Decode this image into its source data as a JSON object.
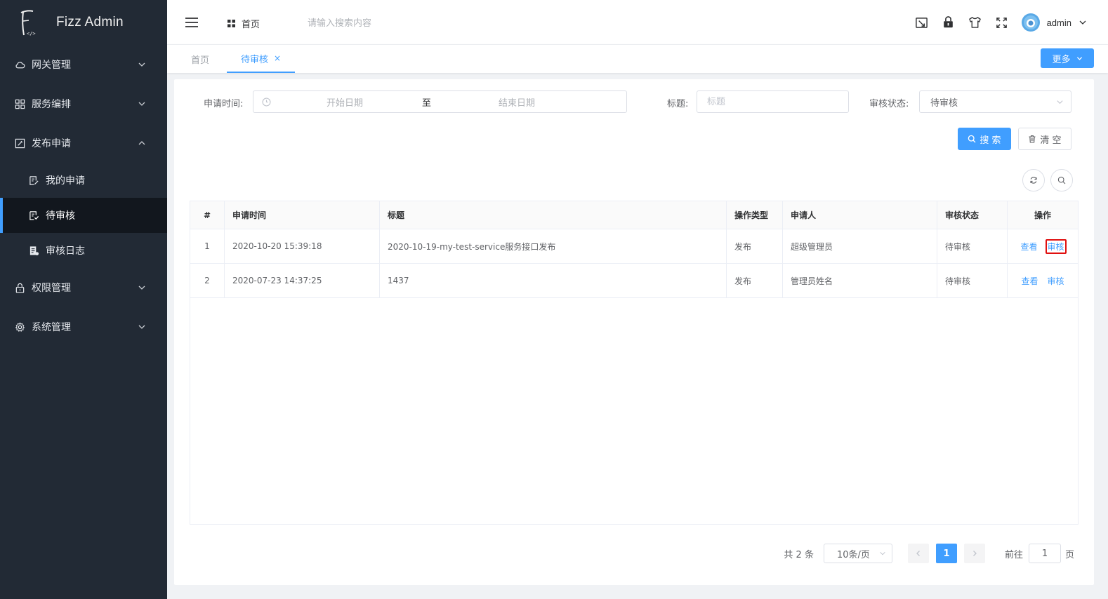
{
  "app": {
    "title": "Fizz Admin"
  },
  "sidebar": {
    "menus": [
      {
        "label": "网关管理",
        "icon": "cloud-icon",
        "expanded": false
      },
      {
        "label": "服务编排",
        "icon": "grid-icon",
        "expanded": false
      },
      {
        "label": "发布申请",
        "icon": "edit-box-icon",
        "expanded": true,
        "children": [
          {
            "label": "我的申请",
            "icon": "document-edit-icon",
            "active": false
          },
          {
            "label": "待审核",
            "icon": "document-check-icon",
            "active": true
          },
          {
            "label": "审核日志",
            "icon": "document-log-icon",
            "active": false
          }
        ]
      },
      {
        "label": "权限管理",
        "icon": "lock-icon",
        "expanded": false
      },
      {
        "label": "系统管理",
        "icon": "gear-icon",
        "expanded": false
      }
    ]
  },
  "header": {
    "breadcrumb": "首页",
    "search_placeholder": "请输入搜索内容",
    "user_name": "admin"
  },
  "tabs": [
    {
      "label": "首页",
      "active": false
    },
    {
      "label": "待审核",
      "active": true,
      "close": "×"
    }
  ],
  "more_button": "更多",
  "filters": {
    "date_label": "申请时间:",
    "start_placeholder": "开始日期",
    "range_separator": "至",
    "end_placeholder": "结束日期",
    "title_label": "标题:",
    "title_placeholder": "标题",
    "status_label": "审核状态:",
    "status_value": "待审核"
  },
  "buttons": {
    "search": "搜 索",
    "clear": "清 空"
  },
  "table": {
    "headers": [
      "#",
      "申请时间",
      "标题",
      "操作类型",
      "申请人",
      "审核状态",
      "操作"
    ],
    "rows": [
      {
        "index": "1",
        "time": "2020-10-20 15:39:18",
        "title": "2020-10-19-my-test-service服务接口发布",
        "op_type": "发布",
        "applicant": "超级管理员",
        "status": "待审核",
        "view": "查看",
        "review": "审核"
      },
      {
        "index": "2",
        "time": "2020-07-23 14:37:25",
        "title": "1437",
        "op_type": "发布",
        "applicant": "管理员姓名",
        "status": "待审核",
        "view": "查看",
        "review": "审核"
      }
    ]
  },
  "pagination": {
    "total": "共 2 条",
    "page_size": "10条/页",
    "current_page": "1",
    "goto_label": "前往",
    "goto_value": "1",
    "page_suffix": "页"
  },
  "colors": {
    "primary": "#409eff",
    "sidebar_bg": "#222a35",
    "sidebar_active_bg": "#12171e",
    "highlight_border": "#e01010"
  }
}
